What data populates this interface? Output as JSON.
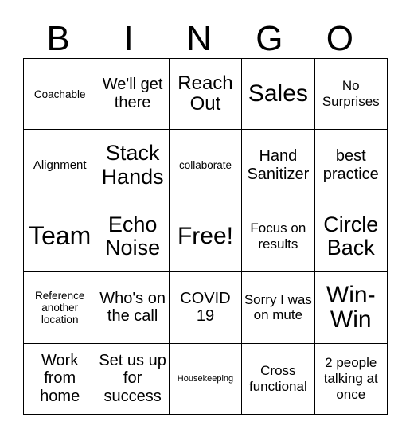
{
  "header": {
    "letters": [
      "B",
      "I",
      "N",
      "G",
      "O"
    ]
  },
  "grid": {
    "rows": [
      [
        {
          "text": "Coachable",
          "size": "fs-sm"
        },
        {
          "text": "We'll get there",
          "size": "fs-lg"
        },
        {
          "text": "Reach Out",
          "size": "fs-xl"
        },
        {
          "text": "Sales",
          "size": "fs-3xl"
        },
        {
          "text": "No Surprises",
          "size": "fs-md"
        }
      ],
      [
        {
          "text": "Alignment",
          "size": "fs-smd"
        },
        {
          "text": "Stack Hands",
          "size": "fs-2xl"
        },
        {
          "text": "collaborate",
          "size": "fs-sm"
        },
        {
          "text": "Hand Sanitizer",
          "size": "fs-lg"
        },
        {
          "text": "best practice",
          "size": "fs-lg"
        }
      ],
      [
        {
          "text": "Team",
          "size": "fs-4xl"
        },
        {
          "text": "Echo Noise",
          "size": "fs-2xl"
        },
        {
          "text": "Free!",
          "size": "fs-3xl"
        },
        {
          "text": "Focus on results",
          "size": "fs-md"
        },
        {
          "text": "Circle Back",
          "size": "fs-2xl"
        }
      ],
      [
        {
          "text": "Reference another location",
          "size": "fs-sm"
        },
        {
          "text": "Who's on the call",
          "size": "fs-lg"
        },
        {
          "text": "COVID 19",
          "size": "fs-lg"
        },
        {
          "text": "Sorry I was on mute",
          "size": "fs-md"
        },
        {
          "text": "Win-Win",
          "size": "fs-3xl"
        }
      ],
      [
        {
          "text": "Work from home",
          "size": "fs-lg"
        },
        {
          "text": "Set us up for success",
          "size": "fs-lg"
        },
        {
          "text": "Housekeeping",
          "size": "fs-xs"
        },
        {
          "text": "Cross functional",
          "size": "fs-md"
        },
        {
          "text": "2 people talking at once",
          "size": "fs-md"
        }
      ]
    ]
  }
}
